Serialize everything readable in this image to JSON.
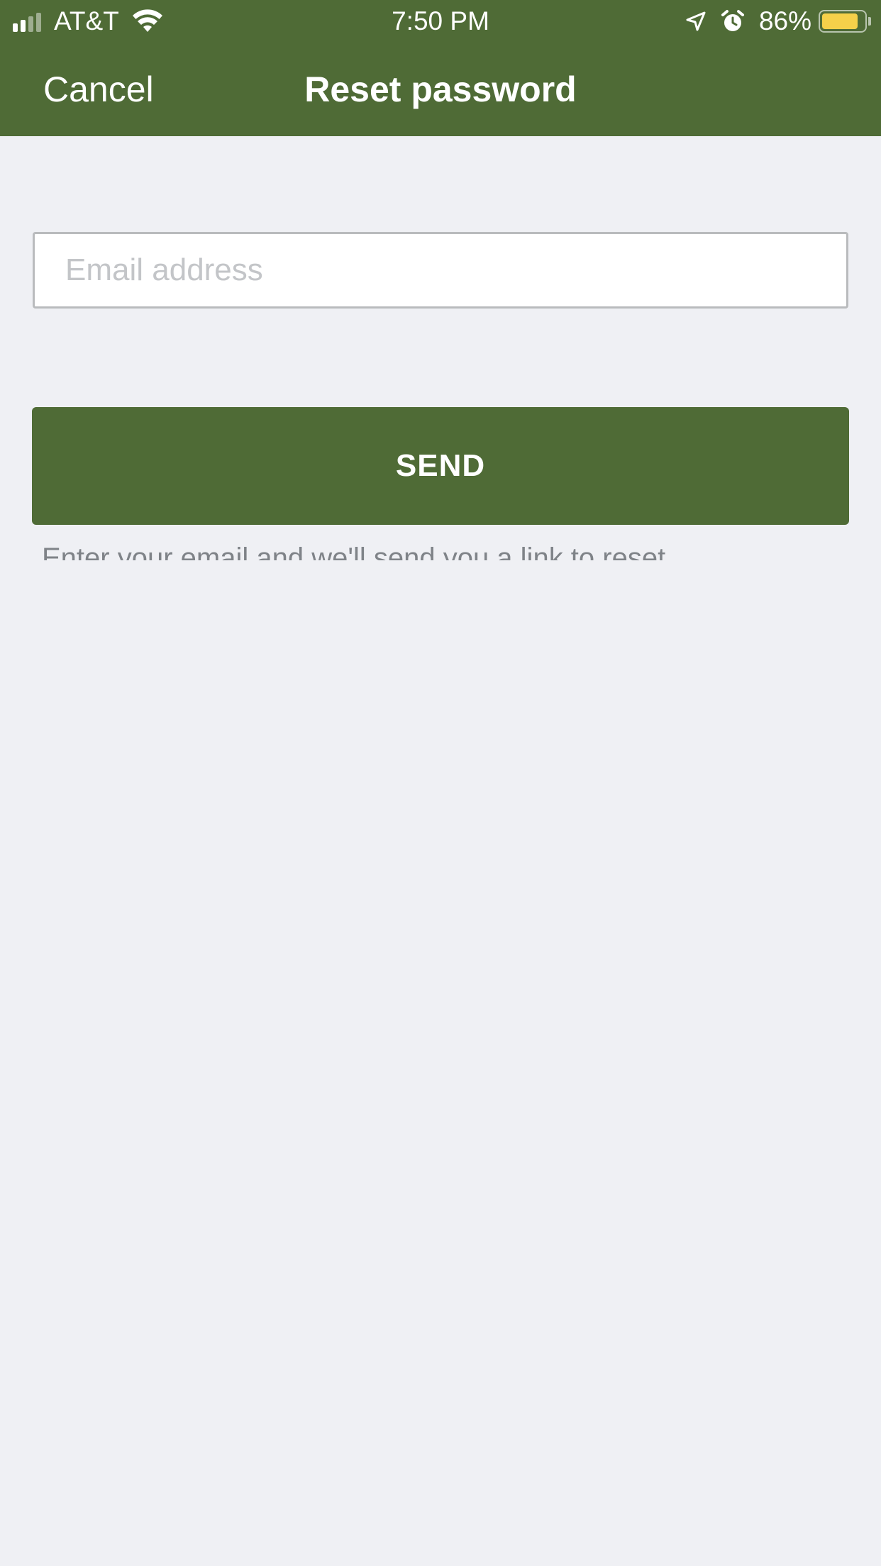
{
  "status_bar": {
    "carrier": "AT&T",
    "time": "7:50 PM",
    "battery_percent": "86%",
    "battery_level": 0.86,
    "icons": [
      "signal-icon",
      "wifi-icon",
      "location-icon",
      "alarm-icon",
      "battery-icon"
    ]
  },
  "nav": {
    "cancel_label": "Cancel",
    "title": "Reset password"
  },
  "form": {
    "email_placeholder": "Email address",
    "email_value": "",
    "send_label": "SEND",
    "help_text": "Enter your email and we'll send you a link to reset"
  },
  "colors": {
    "brand_green": "#4f6b36",
    "background": "#eff0f4",
    "battery_fill": "#f5d04a"
  }
}
